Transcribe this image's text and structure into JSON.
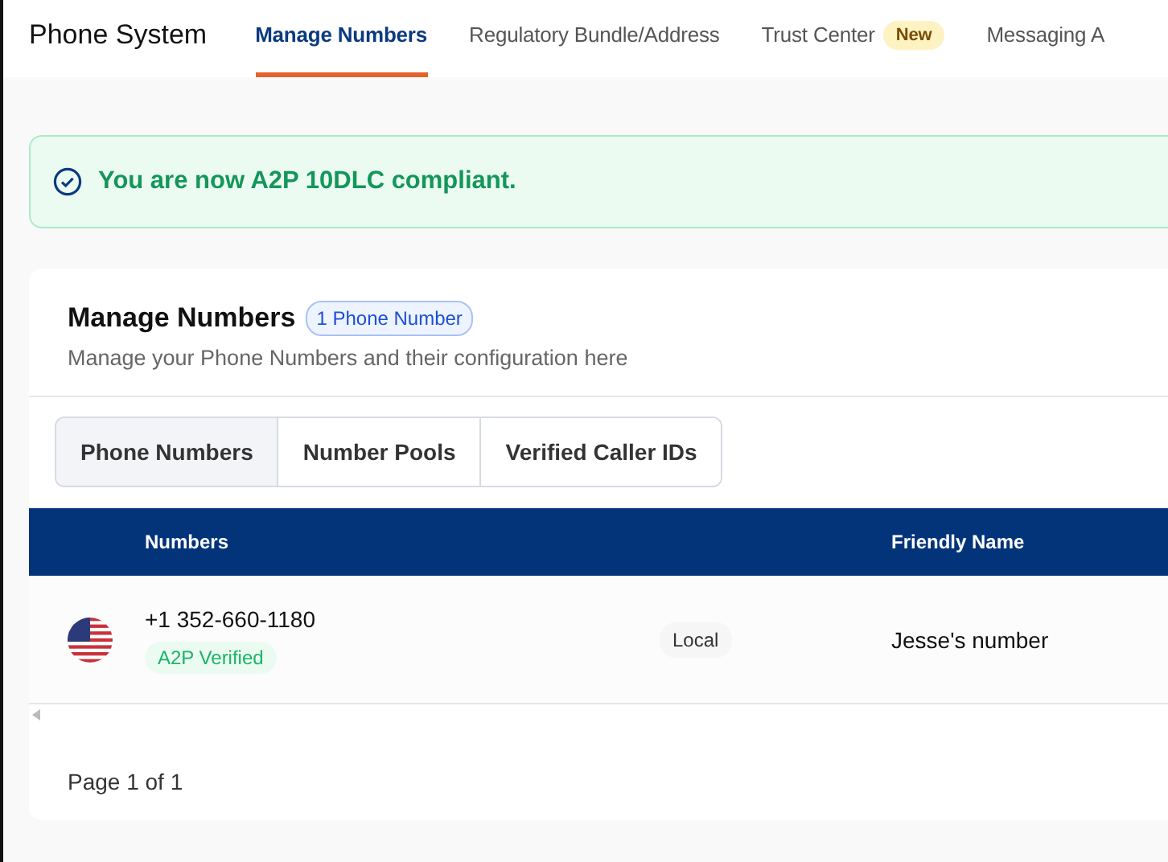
{
  "app_title": "Phone System",
  "nav_tabs": [
    {
      "label": "Manage Numbers",
      "selected": true
    },
    {
      "label": "Regulatory Bundle/Address",
      "selected": false
    },
    {
      "label": "Trust Center",
      "selected": false,
      "badge": "New"
    },
    {
      "label": "Messaging A",
      "selected": false
    }
  ],
  "banner": {
    "text": "You are now A2P 10DLC compliant."
  },
  "card": {
    "title": "Manage Numbers",
    "count_badge": "1 Phone Number",
    "subtitle": "Manage your Phone Numbers and their configuration here",
    "segments": [
      {
        "label": "Phone Numbers",
        "selected": true
      },
      {
        "label": "Number Pools",
        "selected": false
      },
      {
        "label": "Verified Caller IDs",
        "selected": false
      }
    ],
    "table": {
      "columns": [
        "Numbers",
        "Friendly Name"
      ],
      "rows": [
        {
          "number": "+1 352-660-1180",
          "status": "A2P Verified",
          "type": "Local",
          "friendly_name": "Jesse's number"
        }
      ]
    },
    "pagination": "Page 1 of 1"
  }
}
